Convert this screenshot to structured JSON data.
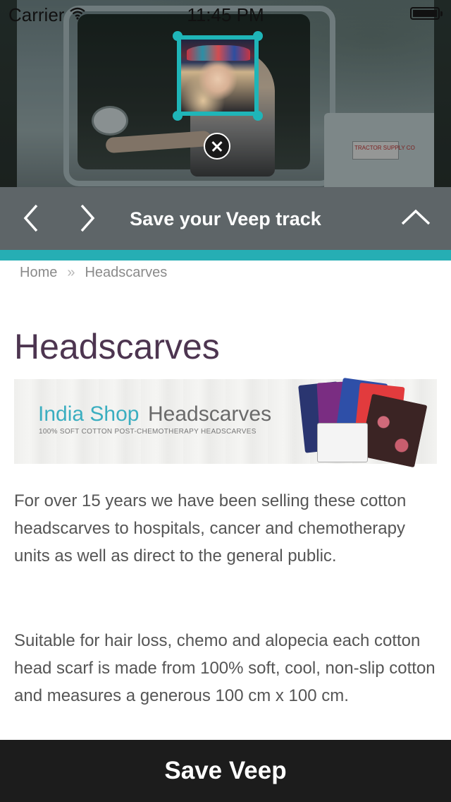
{
  "status_bar": {
    "carrier": "Carrier",
    "time": "11:45 PM"
  },
  "hero": {
    "plate_text": "TRACTOR SUPPLY CO"
  },
  "trackbar": {
    "title": "Save your Veep track"
  },
  "breadcrumb": {
    "home": "Home",
    "separator": "»",
    "current": "Headscarves"
  },
  "page": {
    "title": "Headscarves",
    "banner": {
      "brand_left": "India Shop",
      "brand_right": "Headscarves",
      "subtitle": "100% SOFT COTTON POST-CHEMOTHERAPY HEADSCARVES"
    },
    "paragraphs": [
      "For over 15 years we have been selling these cotton headscarves to hospitals, cancer and chemotherapy units as well as direct to the general public.",
      "Suitable for hair loss, chemo and alopecia each cotton head scarf is made from 100% soft, cool, non-slip cotton and measures a generous 100 cm x 100 cm."
    ]
  },
  "save_button": {
    "label": "Save Veep"
  },
  "colors": {
    "accent": "#26aeb4",
    "title": "#4d3550",
    "trackbar": "#5e6568",
    "button": "#1c1c1c"
  },
  "icons": [
    "wifi-icon",
    "battery-icon",
    "close-icon",
    "chevron-left-icon",
    "chevron-right-icon",
    "chevron-up-icon"
  ]
}
